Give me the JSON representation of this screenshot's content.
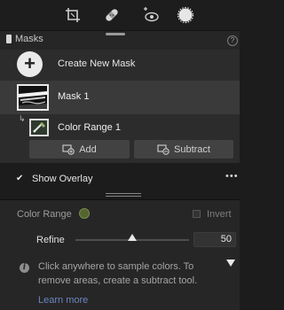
{
  "toolbar": {
    "tools": [
      {
        "icon": "crop-icon"
      },
      {
        "icon": "healing-icon"
      },
      {
        "icon": "red-eye-icon"
      },
      {
        "icon": "masking-icon",
        "active": true
      }
    ]
  },
  "masks_panel": {
    "title": "Masks",
    "help_glyph": "?",
    "create_label": "Create New Mask",
    "plus_glyph": "+",
    "masks": [
      {
        "label": "Mask 1",
        "selected": true
      }
    ],
    "components": [
      {
        "label": "Color Range 1"
      }
    ],
    "add_label": "Add",
    "subtract_label": "Subtract"
  },
  "overlay": {
    "label": "Show Overlay",
    "checked": true,
    "check_glyph": "✔",
    "more_glyph": "•••"
  },
  "color_range": {
    "title": "Color Range",
    "swatch_color": "#55652f",
    "invert_label": "Invert",
    "invert_checked": false,
    "refine_label": "Refine",
    "refine_value": "50",
    "refine_fraction": 0.5,
    "info_glyph": "i",
    "info_text": "Click anywhere to sample colors. To remove areas, create a subtract tool.",
    "learn_more": "Learn more"
  },
  "colors": {
    "background": "#1c1c1c",
    "panel": "#2c2c2c",
    "selected_row": "#3a3a3a",
    "link": "#6b84c2"
  }
}
